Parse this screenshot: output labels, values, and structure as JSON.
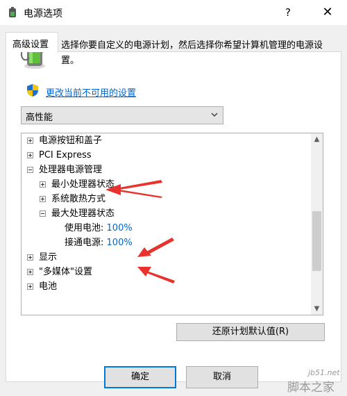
{
  "window": {
    "title": "电源选项",
    "help": "?",
    "close": "✕"
  },
  "tab": {
    "label": "高级设置"
  },
  "intro": {
    "description": "选择你要自定义的电源计划，然后选择你希望计算机管理的电源设置。",
    "change_link": "更改当前不可用的设置"
  },
  "plan": {
    "selected": "高性能"
  },
  "tree": {
    "items": [
      {
        "label": "电源按钮和盖子",
        "state": "collapsed"
      },
      {
        "label": "PCI Express",
        "state": "collapsed"
      },
      {
        "label": "处理器电源管理",
        "state": "expanded"
      },
      {
        "label": "最小处理器状态",
        "state": "collapsed"
      },
      {
        "label": "系统散热方式",
        "state": "collapsed"
      },
      {
        "label": "最大处理器状态",
        "state": "expanded"
      },
      {
        "label": "使用电池:",
        "value": "100%"
      },
      {
        "label": "接通电源:",
        "value": "100%"
      },
      {
        "label": "显示",
        "state": "collapsed"
      },
      {
        "label": "\"多媒体\"设置",
        "state": "collapsed"
      },
      {
        "label": "电池",
        "state": "collapsed"
      }
    ]
  },
  "buttons": {
    "restore": "还原计划默认值(R)",
    "ok": "确定",
    "cancel": "取消"
  },
  "watermark": {
    "line1": "jb51.net",
    "line2": "脚本之家"
  },
  "colors": {
    "link": "#0066cc",
    "arrow": "#e8322d",
    "focus": "#0078d7"
  }
}
